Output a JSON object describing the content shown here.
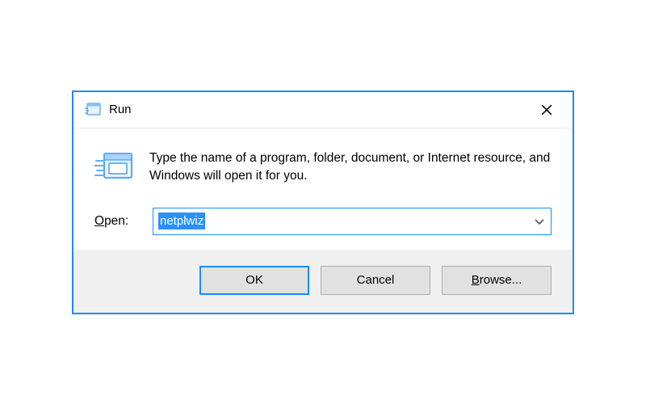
{
  "title": "Run",
  "description": "Type the name of a program, folder, document, or Internet resource, and Windows will open it for you.",
  "open": {
    "label_access": "O",
    "label_rest": "pen:",
    "value": "netplwiz"
  },
  "buttons": {
    "ok": "OK",
    "cancel": "Cancel",
    "browse_access": "B",
    "browse_rest": "rowse..."
  }
}
